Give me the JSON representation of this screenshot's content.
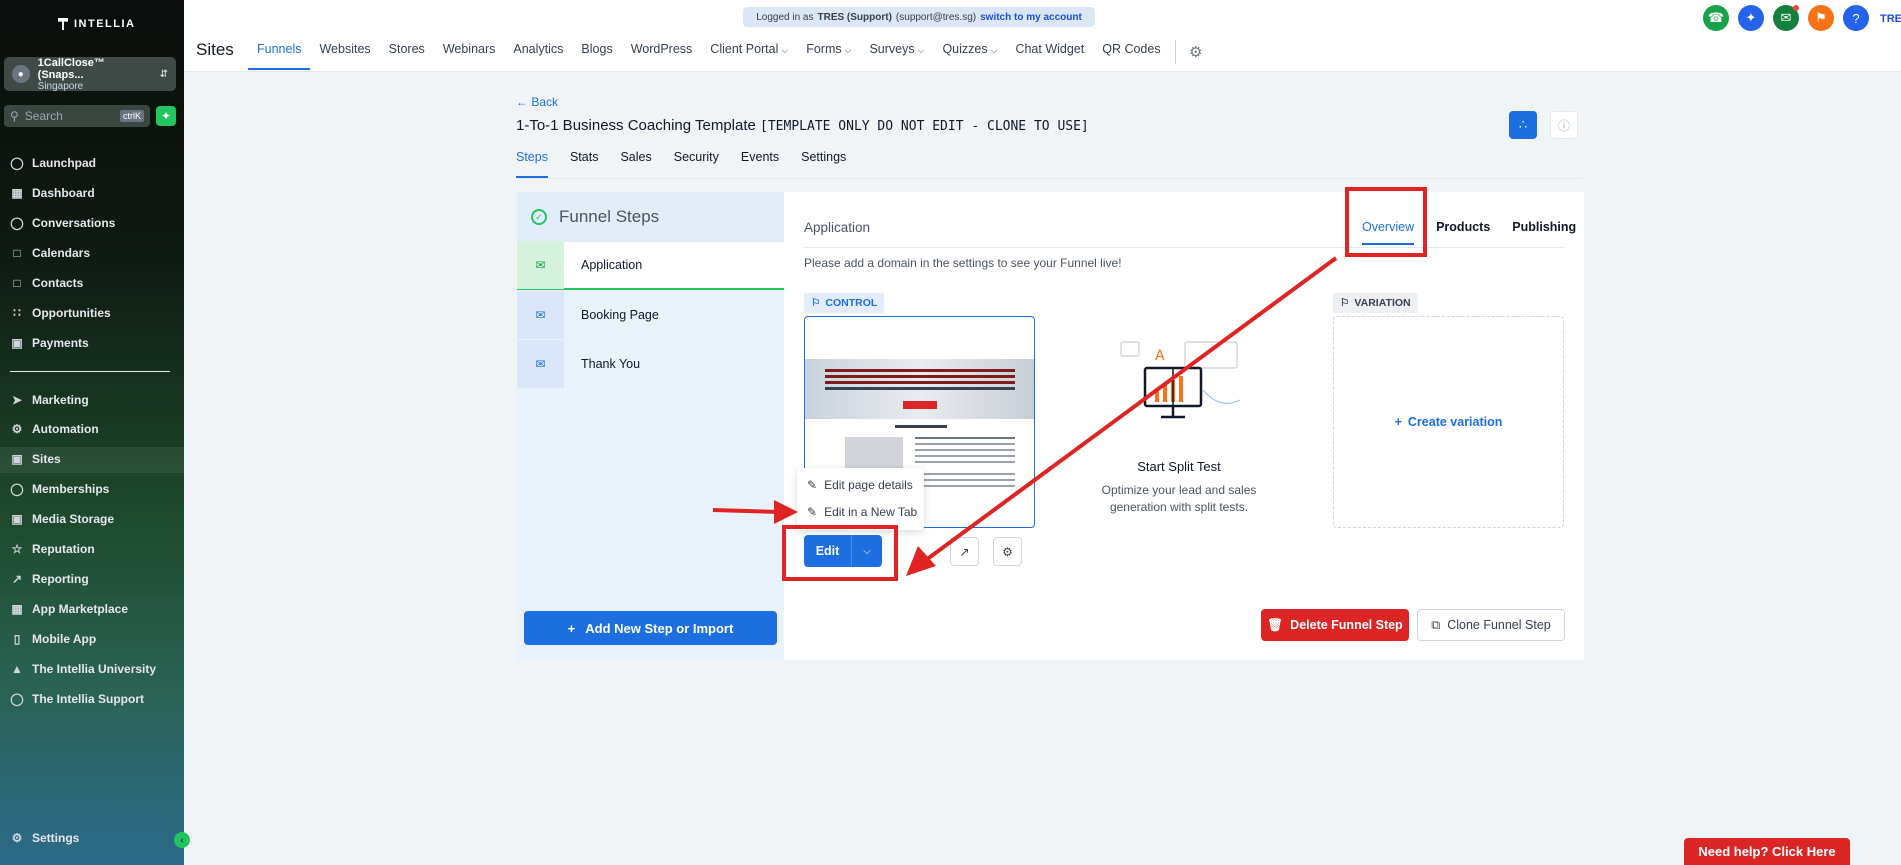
{
  "sidebar": {
    "logo": "INTELLIA",
    "account": {
      "name": "1CallClose™ (Snaps...",
      "location": "Singapore"
    },
    "search": {
      "placeholder": "Search",
      "shortcut": "ctrlK"
    },
    "items": [
      {
        "label": "Launchpad",
        "icon": "rocket-icon"
      },
      {
        "label": "Dashboard",
        "icon": "grid-icon"
      },
      {
        "label": "Conversations",
        "icon": "chat-icon"
      },
      {
        "label": "Calendars",
        "icon": "calendar-icon"
      },
      {
        "label": "Contacts",
        "icon": "contact-icon"
      },
      {
        "label": "Opportunities",
        "icon": "opportunities-icon"
      },
      {
        "label": "Payments",
        "icon": "payments-icon"
      },
      {
        "label": "Marketing",
        "icon": "send-icon"
      },
      {
        "label": "Automation",
        "icon": "automation-icon"
      },
      {
        "label": "Sites",
        "icon": "sites-icon"
      },
      {
        "label": "Memberships",
        "icon": "memberships-icon"
      },
      {
        "label": "Media Storage",
        "icon": "image-icon"
      },
      {
        "label": "Reputation",
        "icon": "reputation-icon"
      },
      {
        "label": "Reporting",
        "icon": "chart-line-icon"
      },
      {
        "label": "App Marketplace",
        "icon": "apps-icon"
      },
      {
        "label": "Mobile App",
        "icon": "mobile-icon"
      },
      {
        "label": "The Intellia University",
        "icon": "graduation-icon"
      },
      {
        "label": "The Intellia Support",
        "icon": "support-icon"
      }
    ],
    "settings": "Settings"
  },
  "banner": {
    "text": "Logged in as",
    "user": "TRES (Support)",
    "email": "(support@tres.sg)",
    "link": "switch to my account"
  },
  "header": {
    "title": "Sites",
    "tabs": [
      "Funnels",
      "Websites",
      "Stores",
      "Webinars",
      "Analytics",
      "Blogs",
      "WordPress",
      "Client Portal",
      "Forms",
      "Surveys",
      "Quizzes",
      "Chat Widget",
      "QR Codes"
    ],
    "user_short": "TRES"
  },
  "funnel": {
    "back": "Back",
    "title": "1-To-1 Business Coaching Template",
    "title_note": "[TEMPLATE ONLY DO NOT EDIT - CLONE TO USE]",
    "tabs": [
      "Steps",
      "Stats",
      "Sales",
      "Security",
      "Events",
      "Settings"
    ]
  },
  "steps_panel": {
    "heading": "Funnel Steps",
    "steps": [
      "Application",
      "Booking Page",
      "Thank You"
    ],
    "add_button": "Add New Step or Import"
  },
  "step_detail": {
    "name": "Application",
    "tabs": [
      "Overview",
      "Products",
      "Publishing"
    ],
    "domain_note": "Please add a domain in the settings to see your Funnel live!",
    "control_badge": "CONTROL",
    "variation_badge": "VARIATION",
    "edit_label": "Edit",
    "menu": [
      "Edit page details",
      "Edit in a New Tab"
    ],
    "split_title": "Start Split Test",
    "split_sub": "Optimize your lead and sales generation with split tests.",
    "create_variation": "Create variation",
    "delete_button": "Delete Funnel Step",
    "clone_button": "Clone Funnel Step"
  },
  "help_button": "Need help? Click Here",
  "colors": {
    "accent": "#1d6fe0",
    "danger": "#dc2626",
    "annotation": "#e02424",
    "success": "#22c55e"
  }
}
